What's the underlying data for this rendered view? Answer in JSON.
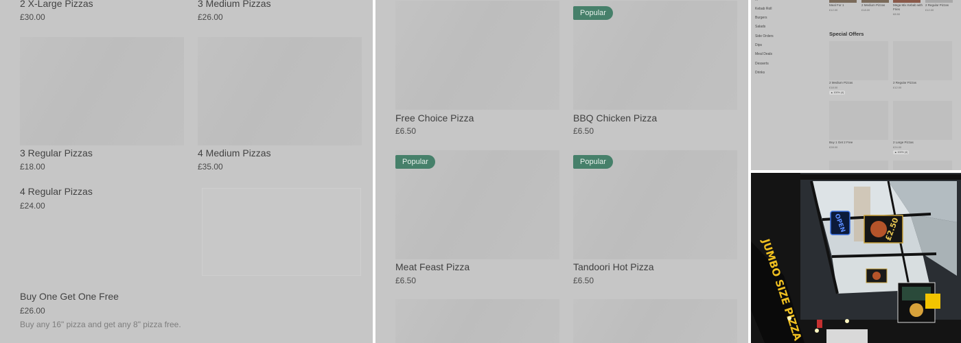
{
  "panel_left": {
    "items": [
      {
        "title": "2 X-Large Pizzas",
        "price": "£30.00"
      },
      {
        "title": "3 Medium Pizzas",
        "price": "£26.00"
      },
      {
        "title": "3 Regular Pizzas",
        "price": "£18.00"
      },
      {
        "title": "4 Medium Pizzas",
        "price": "£35.00"
      },
      {
        "title": "4 Regular Pizzas",
        "price": "£24.00"
      },
      {
        "title": "Buy One Get One Free",
        "price": "£26.00",
        "description": "Buy any 16\" pizza and get any 8\" pizza free."
      }
    ]
  },
  "panel_middle": {
    "badge_label": "Popular",
    "items": [
      {
        "title": "Free Choice Pizza",
        "price": "£6.50"
      },
      {
        "title": "BBQ Chicken Pizza",
        "price": "£6.50"
      },
      {
        "title": "Meat Feast Pizza",
        "price": "£6.50"
      },
      {
        "title": "Tandoori Hot Pizza",
        "price": "£6.50"
      }
    ]
  },
  "panel_overview": {
    "nav_items": [
      "Kebab Roll",
      "Burgers",
      "Salads",
      "Side Orders",
      "Dips",
      "Meal Deals",
      "Desserts",
      "Drinks"
    ],
    "top_row": [
      {
        "label": "Meal For 1",
        "price": "£12.00"
      },
      {
        "label": "2 Medium Pizzas",
        "price": "£18.00"
      },
      {
        "label": "Mega Mix Kebab with Fries",
        "price": "£8.50"
      },
      {
        "label": "2 Regular Pizzas",
        "price": "£12.00"
      }
    ],
    "section_title": "Special Offers",
    "offers": [
      {
        "label": "2 Medium Pizzas",
        "price": "£18.00",
        "rating": "100% (4)"
      },
      {
        "label": "2 Regular Pizzas",
        "price": "£12.00"
      },
      {
        "label": "Buy 1 Get 2 Free",
        "price": "£28.00"
      },
      {
        "label": "2 Large Pizzas",
        "price": "£24.00",
        "rating": "100% (4)"
      }
    ]
  },
  "photo": {
    "open_sign": "OPEN",
    "price_sign": "£2.50",
    "shop_sign": "JUMBO SIZE PIZZA"
  },
  "colors": {
    "overlay_gray": "#c6c6c6",
    "badge_green": "#46806a"
  }
}
